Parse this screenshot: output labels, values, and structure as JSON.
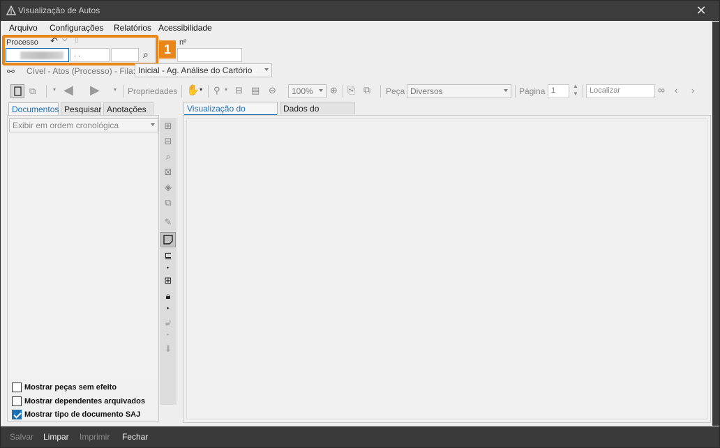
{
  "window": {
    "title": "Visualização de Autos"
  },
  "menu": [
    "Arquivo",
    "Configurações",
    "Relatórios",
    "Acessibilidade"
  ],
  "process": {
    "label": "Processo",
    "number_label": "nº",
    "mask": ". .",
    "annotation": "1",
    "breadcrumb": "Cível - Atos (Processo) - Fila:",
    "queue_value": "Inicial - Ag. Análise do Cartório"
  },
  "toolbar": {
    "properties_label": "Propriedades",
    "zoom_value": "100%",
    "piece_label": "Peça",
    "piece_value": "Diversos",
    "page_label": "Página",
    "page_value": "1",
    "find_placeholder": "Localizar"
  },
  "left_tabs": [
    "Documentos",
    "Pesquisar",
    "Anotações"
  ],
  "right_tabs": [
    "Visualização do Processo",
    "Dados do processo"
  ],
  "order_select": "Exibir em ordem cronológica",
  "checkboxes": [
    {
      "label": "Mostrar peças sem efeito",
      "checked": false
    },
    {
      "label": "Mostrar dependentes arquivados",
      "checked": false
    },
    {
      "label": "Mostrar tipo de documento SAJ",
      "checked": true
    }
  ],
  "bottom_actions": [
    {
      "label": "Salvar",
      "enabled": false
    },
    {
      "label": "Limpar",
      "enabled": true
    },
    {
      "label": "Imprimir",
      "enabled": false
    },
    {
      "label": "Fechar",
      "enabled": true
    }
  ],
  "colors": {
    "accent": "#1a6fb5",
    "highlight": "#e8861a",
    "titlebar": "#3c3c3c"
  }
}
